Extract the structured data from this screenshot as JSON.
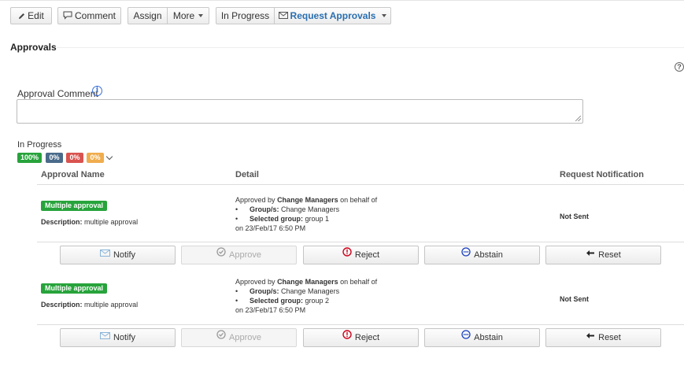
{
  "toolbar": {
    "edit": "Edit",
    "comment": "Comment",
    "assign": "Assign",
    "more": "More",
    "status": "In Progress",
    "request_approvals": "Request Approvals"
  },
  "section": {
    "title": "Approvals"
  },
  "approval_comment": {
    "label": "Approval Comment",
    "value": ""
  },
  "progress": {
    "label": "In Progress",
    "badges": [
      {
        "text": "100%",
        "color": "#27a33b"
      },
      {
        "text": "0%",
        "color": "#4a6b8a"
      },
      {
        "text": "0%",
        "color": "#d9534f"
      },
      {
        "text": "0%",
        "color": "#f0ad4e"
      }
    ]
  },
  "table": {
    "headers": {
      "name": "Approval Name",
      "detail": "Detail",
      "notification": "Request Notification"
    },
    "rows": [
      {
        "tag": "Multiple approval",
        "desc_label": "Description:",
        "desc_value": "multiple approval",
        "detail_prefix": "Approved by",
        "detail_group": "Change Managers",
        "detail_suffix": "on behalf of",
        "groups_label": "Group/s:",
        "groups_value": "Change Managers",
        "selected_label": "Selected group:",
        "selected_value": "group 1",
        "date": "on 23/Feb/17 6:50 PM",
        "notification": "Not Sent"
      },
      {
        "tag": "Multiple approval",
        "desc_label": "Description:",
        "desc_value": "multiple approval",
        "detail_prefix": "Approved by",
        "detail_group": "Change Managers",
        "detail_suffix": "on behalf of",
        "groups_label": "Group/s:",
        "groups_value": "Change Managers",
        "selected_label": "Selected group:",
        "selected_value": "group 2",
        "date": "on 23/Feb/17 6:50 PM",
        "notification": "Not Sent"
      }
    ]
  },
  "actions": {
    "notify": "Notify",
    "approve": "Approve",
    "reject": "Reject",
    "abstain": "Abstain",
    "reset": "Reset"
  }
}
